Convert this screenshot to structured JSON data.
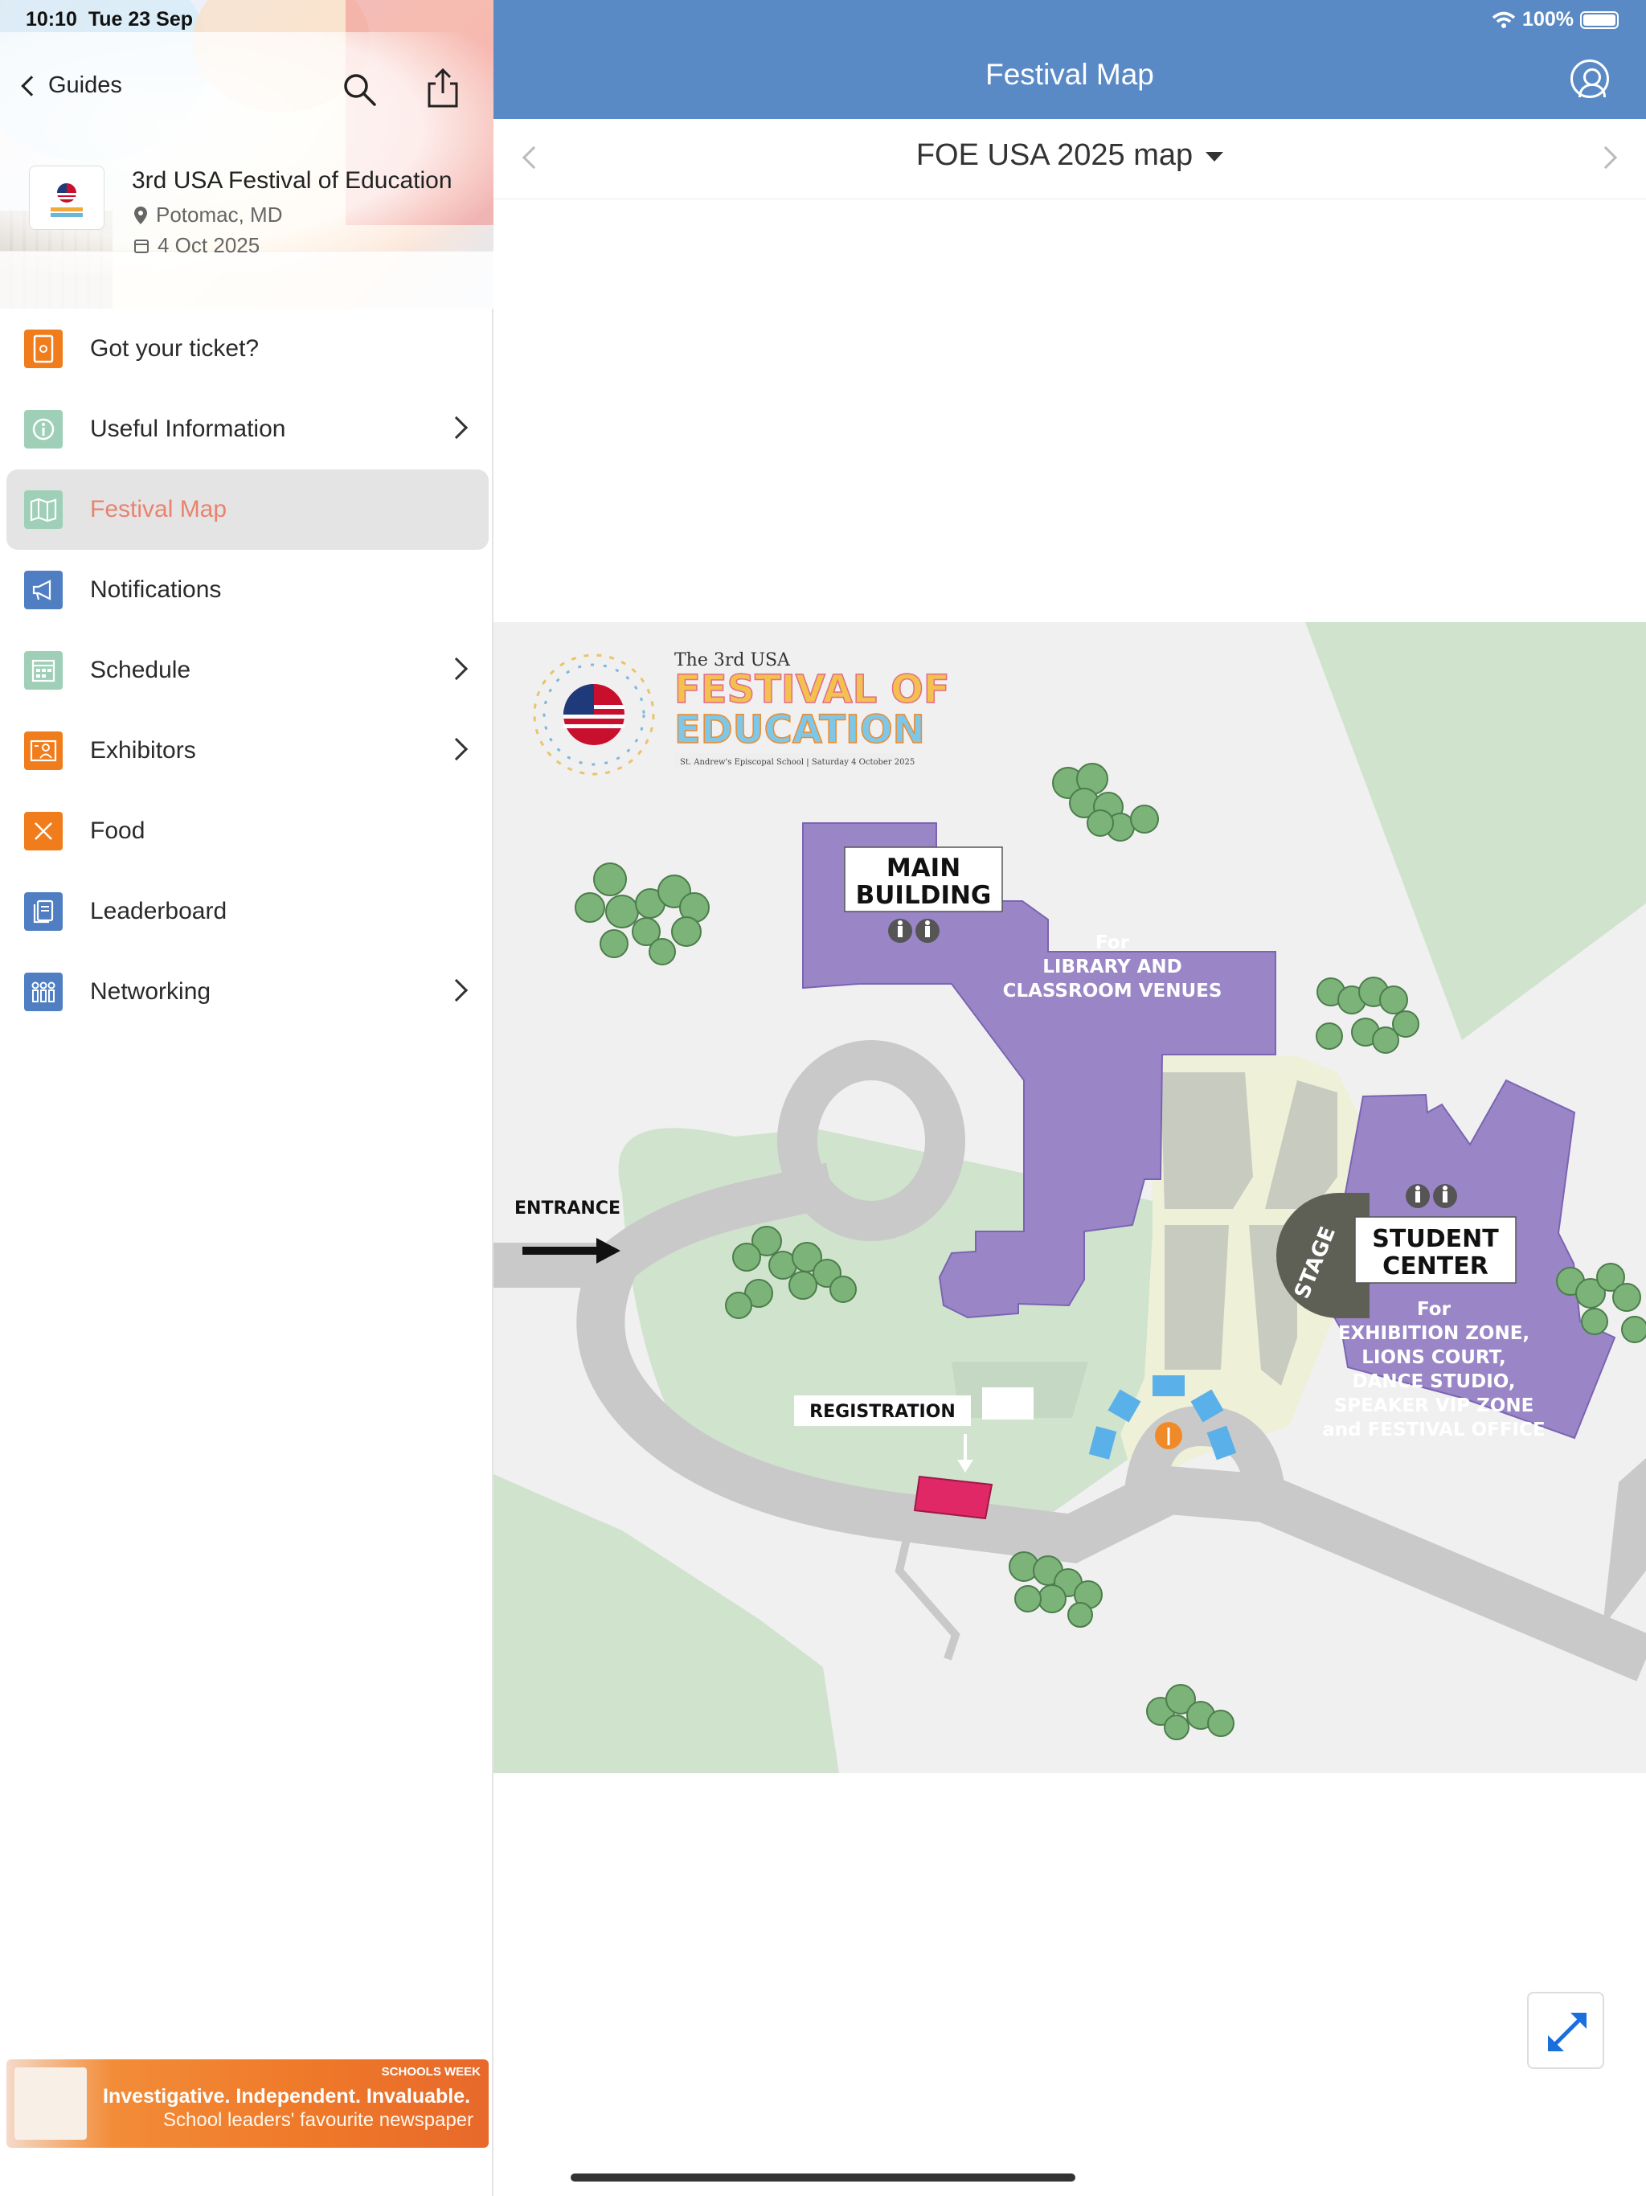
{
  "status_bar": {
    "time": "10:10",
    "date": "Tue 23 Sep",
    "battery": "100%"
  },
  "sidebar": {
    "back_label": "Guides",
    "event": {
      "title": "3rd USA Festival of Education",
      "location": "Potomac, MD",
      "date": "4 Oct 2025"
    },
    "items": [
      {
        "label": "Got your ticket?",
        "icon": "ticket-icon",
        "color": "#f07c1c",
        "chevron": false,
        "active": false
      },
      {
        "label": "Useful Information",
        "icon": "info-icon",
        "color": "#9fd0b7",
        "chevron": true,
        "active": false
      },
      {
        "label": "Festival Map",
        "icon": "map-icon",
        "color": "#9fd0b7",
        "chevron": false,
        "active": true
      },
      {
        "label": "Notifications",
        "icon": "megaphone-icon",
        "color": "#4f7fc2",
        "chevron": false,
        "active": false
      },
      {
        "label": "Schedule",
        "icon": "calendar-icon",
        "color": "#9fd0b7",
        "chevron": true,
        "active": false
      },
      {
        "label": "Exhibitors",
        "icon": "exhibitors-icon",
        "color": "#f07c1c",
        "chevron": true,
        "active": false
      },
      {
        "label": "Food",
        "icon": "food-icon",
        "color": "#f07c1c",
        "chevron": false,
        "active": false
      },
      {
        "label": "Leaderboard",
        "icon": "leaderboard-icon",
        "color": "#4f7fc2",
        "chevron": false,
        "active": false
      },
      {
        "label": "Networking",
        "icon": "networking-icon",
        "color": "#4f7fc2",
        "chevron": true,
        "active": false
      }
    ],
    "ad": {
      "line1": "Investigative. Independent. Invaluable.",
      "line2": "School leaders' favourite newspaper",
      "tag": "SCHOOLS WEEK"
    }
  },
  "main": {
    "title": "Festival Map",
    "map_selector": "FOE USA 2025 map",
    "map": {
      "logo_small": "The 3rd USA",
      "logo_big1": "FESTIVAL OF",
      "logo_big2": "EDUCATION",
      "logo_sub": "St. Andrew's Episcopal School | Saturday 4 October 2025",
      "main_building": "MAIN BUILDING",
      "main_building_line1": "MAIN",
      "main_building_line2": "BUILDING",
      "main_for_1": "For",
      "main_for_2": "LIBRARY AND",
      "main_for_3": "CLASSROOM VENUES",
      "student_line1": "STUDENT",
      "student_line2": "CENTER",
      "student_for_1": "For",
      "student_for_2": "EXHIBITION ZONE,",
      "student_for_3": "LIONS COURT,",
      "student_for_4": "DANCE STUDIO,",
      "student_for_5": "SPEAKER VIP ZONE",
      "student_for_6": "and FESTIVAL OFFICE",
      "entrance": "ENTRANCE",
      "registration": "REGISTRATION",
      "stage": "STAGE"
    }
  },
  "colors": {
    "header": "#5a8ac6",
    "building": "#9a86c6",
    "grass": "#cfe3cd",
    "road": "#c9c9c9",
    "active_text": "#e8836f"
  }
}
